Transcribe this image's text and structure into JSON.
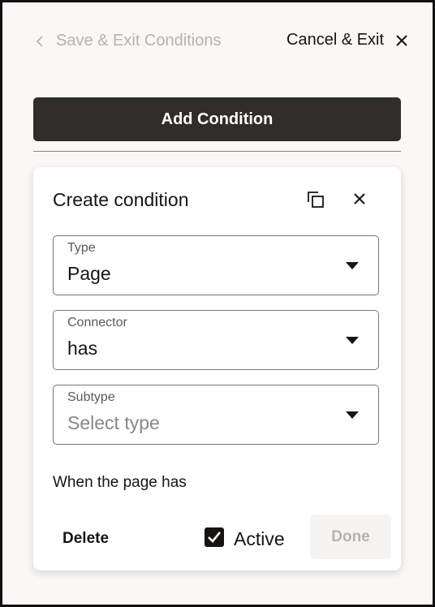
{
  "header": {
    "back_label": "Save & Exit Conditions",
    "cancel_label": "Cancel & Exit"
  },
  "add_condition": {
    "label": "Add Condition"
  },
  "card": {
    "title": "Create condition",
    "fields": [
      {
        "label": "Type",
        "value": "Page"
      },
      {
        "label": "Connector",
        "value": "has"
      },
      {
        "label": "Subtype",
        "value": "",
        "placeholder": "Select type"
      }
    ],
    "description": "When the page has",
    "delete_label": "Delete",
    "active": {
      "label": "Active",
      "checked": true
    },
    "done_label": "Done"
  },
  "icons": {
    "back": "chevron-left-icon",
    "cancel": "close-icon",
    "copy": "copy-icon",
    "close": "close-icon",
    "dropdown": "caret-down-icon",
    "checkbox": "checkmark-icon"
  },
  "colors": {
    "primary_button_bg": "#312d2a",
    "background": "#f9f8f6",
    "text": "#161513",
    "disabled_text": "#b6b2ad"
  }
}
